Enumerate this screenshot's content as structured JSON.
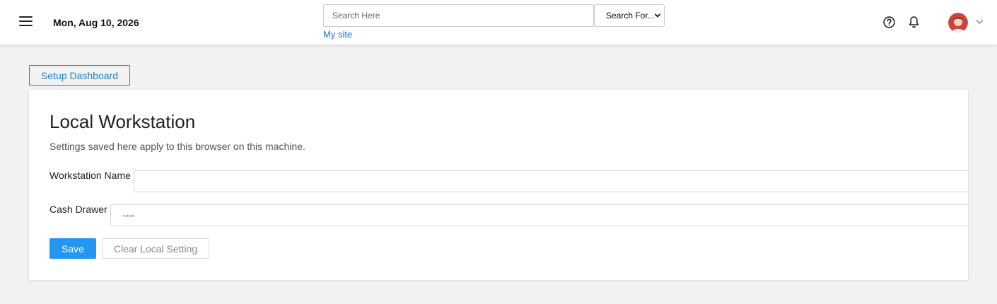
{
  "header": {
    "date": "Mon, Aug 10, 2026",
    "search": {
      "placeholder": "Search Here",
      "value": ""
    },
    "search_type": {
      "selected": "Search For..."
    },
    "site_link": "My site",
    "icons": {
      "menu": "hamburger-menu-icon",
      "help": "help-circle-icon",
      "notifications": "bell-icon",
      "avatar_dropdown": "chevron-down-icon"
    }
  },
  "setup_button": "Setup Dashboard",
  "card": {
    "title": "Local Workstation",
    "description": "Settings saved here apply to this browser on this machine.",
    "fields": {
      "workstation_name": {
        "label": "Workstation Name",
        "value": ""
      },
      "cash_drawer": {
        "label": "Cash Drawer",
        "value": "----"
      }
    },
    "save_label": "Save",
    "clear_label": "Clear Local Setting"
  },
  "colors": {
    "accent": "#2196f3",
    "link": "#1a73d9",
    "outline_button": "#1f7fd1",
    "background": "#f2f2f2"
  }
}
